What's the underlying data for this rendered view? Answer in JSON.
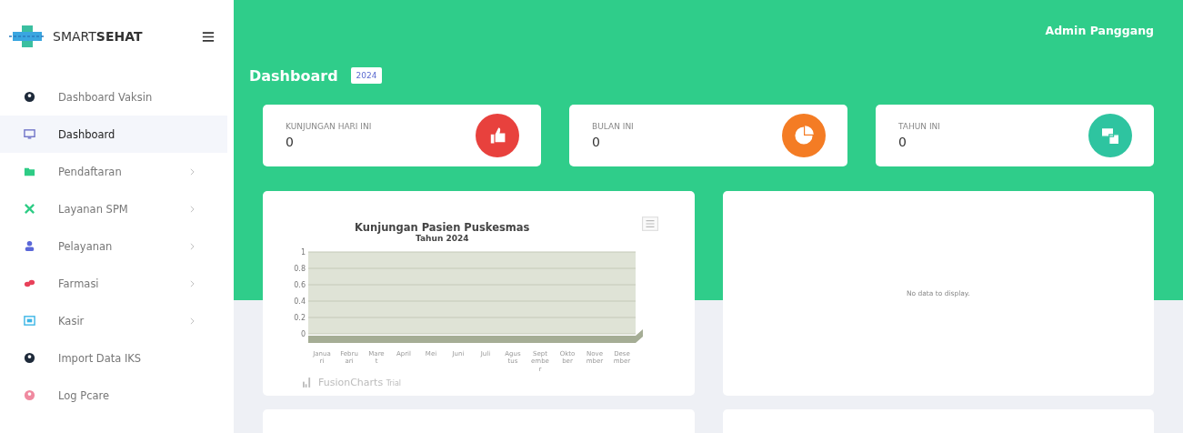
{
  "brand": {
    "light": "SMART",
    "bold": "SEHAT"
  },
  "sidebar": {
    "items": [
      {
        "label": "Dashboard Vaksin",
        "kind": "user",
        "selected": false,
        "submenu": false
      },
      {
        "label": "Dashboard",
        "kind": "monitor",
        "selected": true,
        "submenu": false
      },
      {
        "label": "Pendaftaran",
        "kind": "folder",
        "selected": false,
        "submenu": true
      },
      {
        "label": "Layanan SPM",
        "kind": "tools",
        "selected": false,
        "submenu": true
      },
      {
        "label": "Pelayanan",
        "kind": "person",
        "selected": false,
        "submenu": true
      },
      {
        "label": "Farmasi",
        "kind": "pills",
        "selected": false,
        "submenu": true
      },
      {
        "label": "Kasir",
        "kind": "register",
        "selected": false,
        "submenu": true
      },
      {
        "label": "Import Data IKS",
        "kind": "user",
        "selected": false,
        "submenu": false
      },
      {
        "label": "Log Pcare",
        "kind": "userpink",
        "selected": false,
        "submenu": false
      }
    ]
  },
  "topbar": {
    "user": "Admin Panggang"
  },
  "page": {
    "title": "Dashboard",
    "year": "2024"
  },
  "stats": [
    {
      "label": "KUNJUNGAN HARI INI",
      "value": "0",
      "kind": "thumb",
      "color": "#e8413d"
    },
    {
      "label": "BULAN INI",
      "value": "0",
      "kind": "pie",
      "color": "#f47c24"
    },
    {
      "label": "TAHUN INI",
      "value": "0",
      "kind": "database",
      "color": "#2ec4a0"
    }
  ],
  "visits_chart": {
    "subtitle": "Tahun 2024",
    "chart_data": {
      "type": "bar",
      "title": "Kunjungan Pasien Puskesmas",
      "grid": true,
      "categories": [
        "Januari",
        "Februari",
        "Maret",
        "April",
        "Mei",
        "Juni",
        "Juli",
        "Agustus",
        "September",
        "Oktober",
        "November",
        "Desember"
      ],
      "series": [
        {
          "color": "#a5ad95",
          "values": [
            0,
            0,
            0,
            0,
            0,
            0,
            0,
            0,
            0,
            0,
            0,
            0
          ]
        }
      ],
      "ylim": [
        0,
        1
      ],
      "yticks": [
        0,
        {
          "value": 0.2,
          "label": "0.2"
        },
        {
          "value": 0.4,
          "label": "0.4"
        },
        {
          "value": 0.6,
          "label": "0.6"
        },
        {
          "value": 0.8,
          "label": "0.8"
        },
        1
      ]
    },
    "credit": {
      "name": "FusionCharts",
      "suffix": "Trial"
    }
  },
  "empty_panel": {
    "message": "No data to display."
  }
}
